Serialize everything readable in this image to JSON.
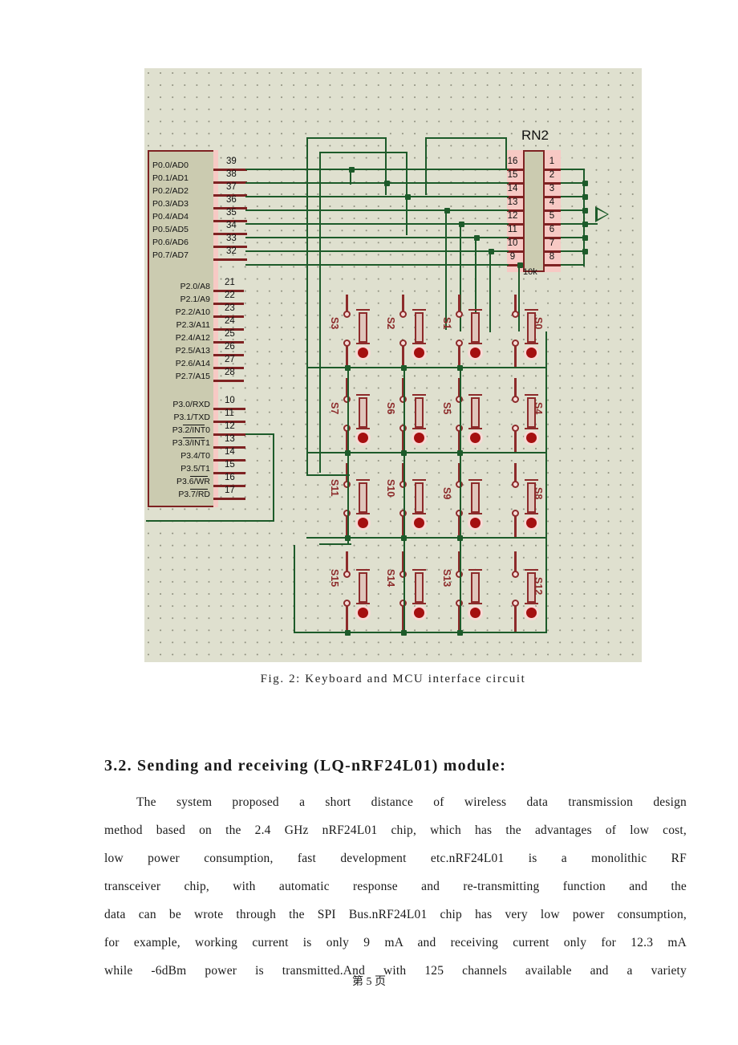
{
  "figure": {
    "caption": "Fig. 2: Keyboard and MCU interface circuit",
    "mcu": {
      "port0": [
        {
          "pin": "39",
          "label": "P0.0/AD0"
        },
        {
          "pin": "38",
          "label": "P0.1/AD1"
        },
        {
          "pin": "37",
          "label": "P0.2/AD2"
        },
        {
          "pin": "36",
          "label": "P0.3/AD3"
        },
        {
          "pin": "35",
          "label": "P0.4/AD4"
        },
        {
          "pin": "34",
          "label": "P0.5/AD5"
        },
        {
          "pin": "33",
          "label": "P0.6/AD6"
        },
        {
          "pin": "32",
          "label": "P0.7/AD7"
        }
      ],
      "port2": [
        {
          "pin": "21",
          "label": "P2.0/A8"
        },
        {
          "pin": "22",
          "label": "P2.1/A9"
        },
        {
          "pin": "23",
          "label": "P2.2/A10"
        },
        {
          "pin": "24",
          "label": "P2.3/A11"
        },
        {
          "pin": "25",
          "label": "P2.4/A12"
        },
        {
          "pin": "26",
          "label": "P2.5/A13"
        },
        {
          "pin": "27",
          "label": "P2.6/A14"
        },
        {
          "pin": "28",
          "label": "P2.7/A15"
        }
      ],
      "port3": [
        {
          "pin": "10",
          "label": "P3.0/RXD"
        },
        {
          "pin": "11",
          "label": "P3.1/TXD"
        },
        {
          "pin": "12",
          "label": "P3.2/INT0"
        },
        {
          "pin": "13",
          "label": "P3.3/INT1"
        },
        {
          "pin": "14",
          "label": "P3.4/T0"
        },
        {
          "pin": "15",
          "label": "P3.5/T1"
        },
        {
          "pin": "16",
          "label": "P3.6/WR"
        },
        {
          "pin": "17",
          "label": "P3.7/RD"
        }
      ]
    },
    "rn2": {
      "ref": "RN2",
      "value": "10k",
      "left_pins": [
        "16",
        "15",
        "14",
        "13",
        "12",
        "11",
        "10",
        "9"
      ],
      "right_pins": [
        "1",
        "2",
        "3",
        "4",
        "5",
        "6",
        "7",
        "8"
      ]
    },
    "switch_matrix": {
      "rows": [
        [
          "S3",
          "S2",
          "S1",
          "S0"
        ],
        [
          "S7",
          "S6",
          "S5",
          "S4"
        ],
        [
          "S11",
          "S10",
          "S9",
          "S8"
        ],
        [
          "S15",
          "S14",
          "S13",
          "S12"
        ]
      ]
    },
    "colors": {
      "canvas": "#dfe0cf",
      "wire": "#1d5b2a",
      "component_outline": "#8d2b2b",
      "component_fill": "#cbcbb0",
      "led": "#a50f10"
    }
  },
  "section": {
    "heading": "3.2. Sending and receiving (LQ-nRF24L01) module:",
    "paragraph_line1": "The system proposed a short distance of wireless data transmission design",
    "paragraph_line2": "method based on the 2.4 GHz nRF24L01 chip, which has the advantages of low cost,",
    "paragraph_line3": "low power consumption, fast development etc.nRF24L01 is a monolithic RF",
    "paragraph_line4": "transceiver chip, with automatic response and re-transmitting function and the",
    "paragraph_line5": "data can be wrote through the SPI Bus.nRF24L01 chip has very low power consumption,",
    "paragraph_line6": "for example, working current is only 9 mA and receiving current only for 12.3 mA",
    "paragraph_line7": "while -6dBm power is transmitted.And with 125 channels available and a variety"
  },
  "footer": {
    "page": "第 5 页"
  }
}
